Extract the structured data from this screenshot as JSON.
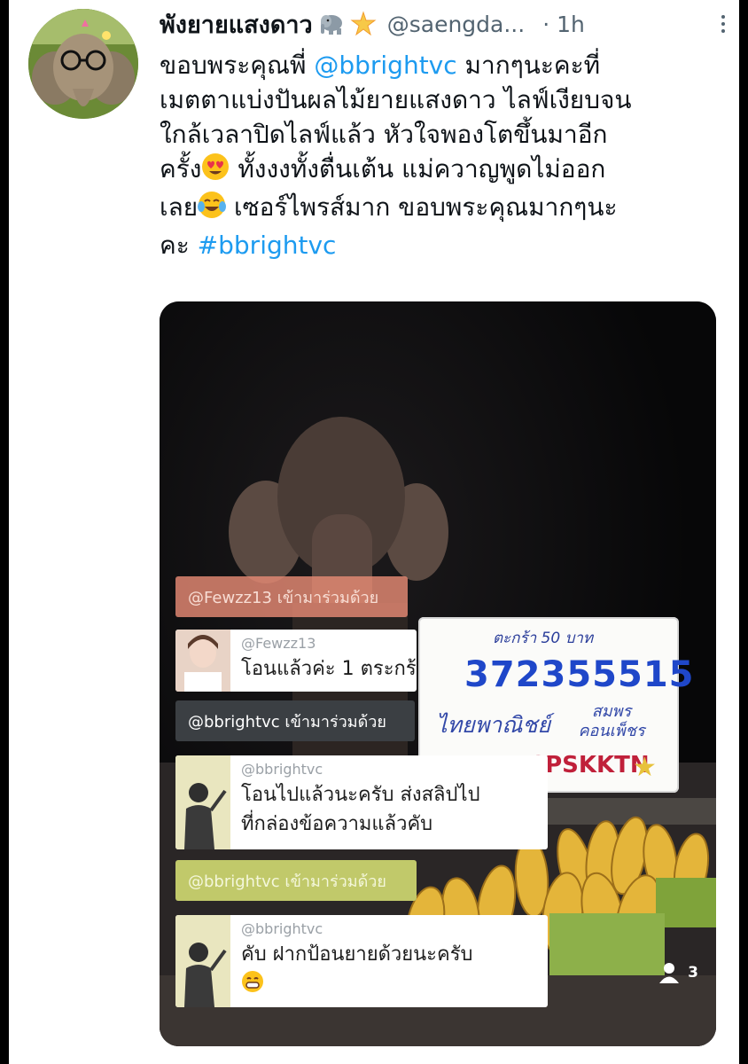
{
  "tweet": {
    "display_name": "พังยายแสงดาว",
    "handle": "@saengda...",
    "time_sep": "·",
    "time": "1h",
    "body": {
      "l1_pre": "ขอบพระคุณพี่ ",
      "l1_mention": "@bbrightvc",
      "l1_post": " มากๆนะคะที่",
      "l2": "เมตตาแบ่งปันผลไม้ยายแสงดาว ไลฟ์เงียบจน",
      "l3": "ใกล้เวลาปิดไลฟ์แล้ว หัวใจพองโตขึ้นมาอีก",
      "l4_pre": "ครั้ง",
      "l4_post": " ทั้งงงทั้งตื่นเต้น แม่ควาญพูดไม่ออก",
      "l5_pre": "เลย",
      "l5_post": " เซอร์ไพรส์มาก ขอบพระคุณมากๆนะ",
      "l6_pre": "คะ ",
      "l6_hashtag": "#bbrightvc"
    },
    "icons": [
      "elephant-emoji",
      "glowing-star-emoji",
      "heart-eyes-emoji",
      "tears-of-joy-emoji",
      "more-icon"
    ]
  },
  "live": {
    "sign": {
      "price": "ตะกร้า 50 บาท",
      "account": "372355515",
      "bank": "ไทยพาณิชย์",
      "name": "สมพร\nคอนเพ็ชร",
      "code": "CPSKKTN"
    },
    "joins": [
      {
        "text": "@Fewzz13 เข้ามาร่วมด้วย"
      },
      {
        "text": "@bbrightvc เข้ามาร่วมด้วย"
      },
      {
        "text": "@bbrightvc เข้ามาร่วมด้วย"
      }
    ],
    "comments": [
      {
        "user": "@Fewzz13",
        "lines": [
          "โอนแล้วค่ะ 1 ตระกร้า"
        ]
      },
      {
        "user": "@bbrightvc",
        "lines": [
          "โอนไปแล้วนะครับ ส่งสลิปไป",
          "ที่กล่องข้อความแล้วคับ"
        ]
      },
      {
        "user": "@bbrightvc",
        "lines": [
          "คับ ฝากป้อนยายด้วยนะครับ"
        ]
      }
    ],
    "viewer_count": "3"
  },
  "colors": {
    "link": "#1d9bf0",
    "text": "#0f1419",
    "muted": "#536471"
  }
}
